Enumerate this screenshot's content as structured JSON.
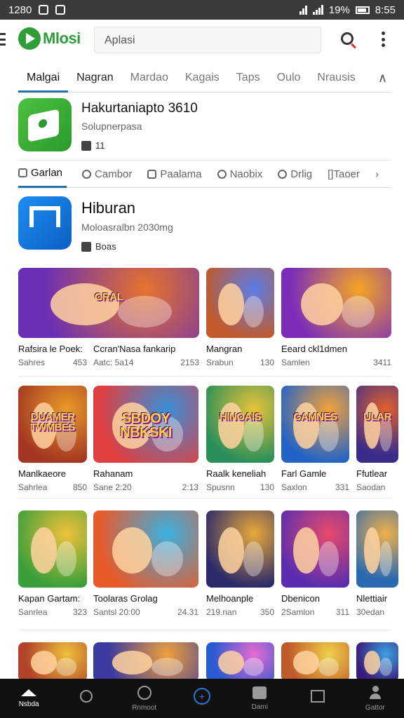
{
  "status": {
    "time_left": "1280",
    "time_right": "8:55",
    "battery": "19%"
  },
  "appbar": {
    "logo_text": "Mlosi",
    "search_placeholder": "Aplasi"
  },
  "tabs1": {
    "items": [
      "Malgai",
      "Nagran",
      "Mardao",
      "Kagais",
      "Taps",
      "Oulo",
      "Nrausis"
    ],
    "active_index": 0,
    "collapse_label": "∧"
  },
  "featured": {
    "title": "Hakurtaniapto 3610",
    "subtitle": "Solupnerpasa",
    "badge": "11"
  },
  "tabs2": {
    "items": [
      "Garlan",
      "Cambor",
      "Paalama",
      "Naobix",
      "Drlig",
      "[]Taoer"
    ],
    "active_index": 0,
    "more": "›"
  },
  "section": {
    "title": "Hiburan",
    "subtitle": "Moloasralbn 2030mg",
    "badge": "Boas"
  },
  "rows": [
    {
      "cards": [
        {
          "title": "Rafsira le Poek:",
          "sub_left": "Sahres",
          "sub_right": "453",
          "caption": "ORAL",
          "colors": [
            "#6a2fb5",
            "#e6732c"
          ]
        },
        {
          "title": "Ccran'Nasa fankarip",
          "sub_left": "Aatc: 5a14",
          "sub_right": "2153",
          "caption": "",
          "colors": [
            "#e64b8a",
            "#f4b23a"
          ]
        },
        {
          "title": "Mangran",
          "sub_left": "Srabun",
          "sub_right": "130",
          "caption": "",
          "colors": [
            "#c25a2b",
            "#5b7de8"
          ]
        },
        {
          "title": "Eeard ckl1dmen",
          "sub_left": "Samlen",
          "sub_right": "3411",
          "caption": "",
          "colors": [
            "#7b2dba",
            "#f5a623"
          ]
        }
      ]
    },
    {
      "cards": [
        {
          "title": "Manlkaeore",
          "sub_left": "Sahrlea",
          "sub_right": "850",
          "caption": "DUAMER TWMBES",
          "colors": [
            "#a43622",
            "#e89a2a"
          ]
        },
        {
          "title": "Rahanam",
          "sub_left": "Sane 2:20",
          "sub_right": "2:13",
          "caption": "SBDOY NBKSKI",
          "colors": [
            "#e03f3f",
            "#3a8fd9"
          ]
        },
        {
          "title": "Raalk keneliah",
          "sub_left": "Spusnn",
          "sub_right": "130",
          "caption": "HINOAIS",
          "colors": [
            "#2a8f5a",
            "#e8c33a"
          ]
        },
        {
          "title": "Farl Gamle",
          "sub_left": "Saxlon",
          "sub_right": "331",
          "caption": "CAMNES",
          "colors": [
            "#2363c7",
            "#f3a13a"
          ]
        },
        {
          "title": "Ffutlear",
          "sub_left": "Saodan",
          "sub_right": "",
          "caption": "ULAR",
          "colors": [
            "#3a2d8a",
            "#e0602e"
          ]
        }
      ]
    },
    {
      "cards": [
        {
          "title": "Kapan Gartam:",
          "sub_left": "Sanrlea",
          "sub_right": "323",
          "caption": "",
          "colors": [
            "#3a9f3a",
            "#f0c23a"
          ]
        },
        {
          "title": "Toolaras Grolag",
          "sub_left": "Santsl 20:00",
          "sub_right": "24.31",
          "caption": "",
          "colors": [
            "#e85a2a",
            "#3ab0e0"
          ]
        },
        {
          "title": "Melhoanple",
          "sub_left": "219.nan",
          "sub_right": "350",
          "caption": "",
          "colors": [
            "#2a2a6a",
            "#e8a83a"
          ]
        },
        {
          "title": "Dbenicon",
          "sub_left": "2Samlon",
          "sub_right": "311",
          "caption": "",
          "colors": [
            "#5a2db0",
            "#e84a6a"
          ]
        },
        {
          "title": "Nlettiair",
          "sub_left": "30edan",
          "sub_right": "",
          "caption": "",
          "colors": [
            "#2a6ab0",
            "#f0b04a"
          ]
        }
      ]
    },
    {
      "cards": [
        {
          "title": "",
          "sub_left": "",
          "sub_right": "",
          "caption": "",
          "colors": [
            "#b0432a",
            "#f0c03a"
          ]
        },
        {
          "title": "",
          "sub_left": "",
          "sub_right": "",
          "caption": "",
          "colors": [
            "#3a3aa0",
            "#f0a03a"
          ]
        },
        {
          "title": "",
          "sub_left": "",
          "sub_right": "",
          "caption": "",
          "colors": [
            "#2a5ad0",
            "#e86ad0"
          ]
        },
        {
          "title": "",
          "sub_left": "",
          "sub_right": "",
          "caption": "",
          "colors": [
            "#c05a2a",
            "#f0d04a"
          ]
        },
        {
          "title": "",
          "sub_left": "",
          "sub_right": "",
          "caption": "",
          "colors": [
            "#3a1a7a",
            "#3aa0e0"
          ]
        }
      ]
    }
  ],
  "bottomnav": {
    "items": [
      {
        "label": "Nsbda",
        "icon": "home-icon"
      },
      {
        "label": "",
        "icon": "search-icon"
      },
      {
        "label": "Rnmoot",
        "icon": "circle-icon"
      },
      {
        "label": "",
        "icon": "center-icon"
      },
      {
        "label": "Dami",
        "icon": "game-icon"
      },
      {
        "label": "",
        "icon": "window-icon"
      },
      {
        "label": "Gattor",
        "icon": "user-icon"
      }
    ],
    "active_index": 0
  },
  "colors": {
    "accent": "#2b6fa8",
    "brand_green": "#2e9d3a",
    "nav_bg": "#111111"
  }
}
